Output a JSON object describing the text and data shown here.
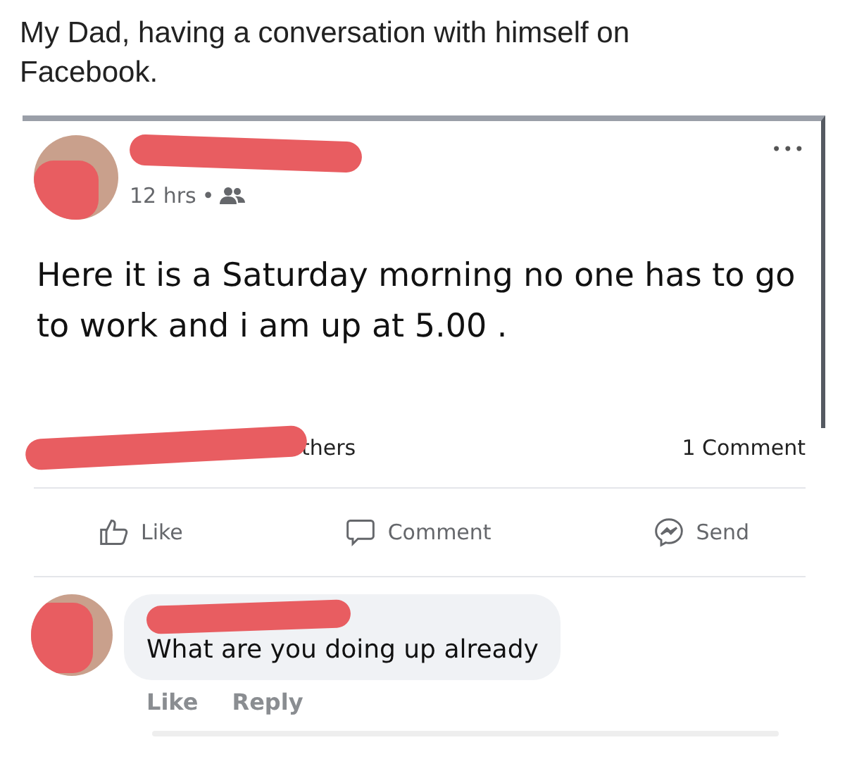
{
  "caption": "My Dad, having a conversation with himself on Facebook.",
  "post": {
    "time": "12 hrs",
    "separator": "•",
    "more": "•••",
    "text": "Here it is a Saturday morning no one has to go to work and i am up at 5.00 .",
    "reactions_text": "thers",
    "comment_count": "1 Comment",
    "actions": [
      {
        "kind": "like",
        "label": "Like"
      },
      {
        "kind": "comment",
        "label": "Comment"
      },
      {
        "kind": "send",
        "label": "Send"
      }
    ]
  },
  "comments": [
    {
      "text": "What are you doing up already",
      "actions": [
        "Like",
        "Reply"
      ]
    }
  ]
}
